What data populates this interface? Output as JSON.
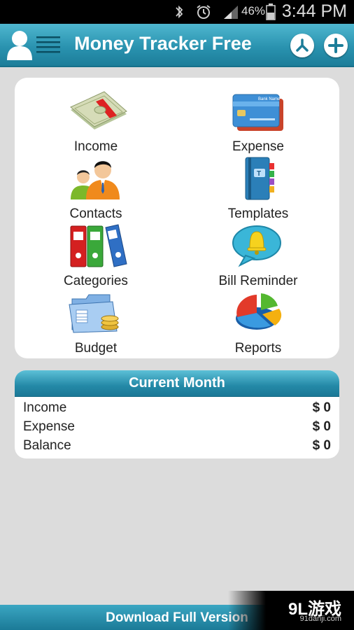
{
  "status_bar": {
    "battery": "46%",
    "time": "3:44 PM"
  },
  "header": {
    "title": "Money Tracker Free"
  },
  "grid": {
    "items": [
      {
        "label": "Income",
        "icon": "money-stack-icon"
      },
      {
        "label": "Expense",
        "icon": "credit-card-icon"
      },
      {
        "label": "Contacts",
        "icon": "people-icon"
      },
      {
        "label": "Templates",
        "icon": "notebook-icon"
      },
      {
        "label": "Categories",
        "icon": "binders-icon"
      },
      {
        "label": "Bill Reminder",
        "icon": "bell-bubble-icon"
      },
      {
        "label": "Budget",
        "icon": "folder-coins-icon"
      },
      {
        "label": "Reports",
        "icon": "pie-chart-icon"
      }
    ],
    "card_text": "Bank Name"
  },
  "current_month": {
    "title": "Current Month",
    "rows": [
      {
        "label": "Income",
        "value": "$ 0"
      },
      {
        "label": "Expense",
        "value": "$ 0"
      },
      {
        "label": "Balance",
        "value": "$ 0"
      }
    ]
  },
  "footer": {
    "label": "Download Full Version"
  },
  "watermark": {
    "logo": "9L游戏",
    "site": "91danji.com"
  },
  "colors": {
    "accent": "#2a93b0",
    "header_dark": "#1c7d99"
  }
}
